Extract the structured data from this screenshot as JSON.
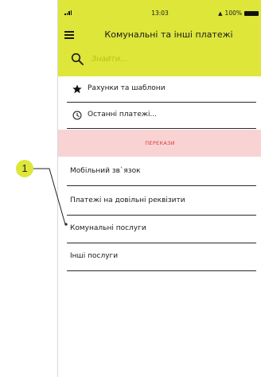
{
  "status_bar": {
    "time": "13:03",
    "battery": "100%"
  },
  "header": {
    "title": "Комунальні та інші платежі"
  },
  "search": {
    "placeholder": "Знайти..."
  },
  "quick_rows": [
    {
      "label": "Рахунки та шаблони",
      "icon": "star-icon"
    },
    {
      "label": "Останні платежі...",
      "icon": "clock-icon"
    }
  ],
  "section": {
    "label": "ПЕРЕКАЗИ"
  },
  "items": [
    {
      "label": "Мобільний зв`язок"
    },
    {
      "label": "Платежі на довільні реквізити"
    },
    {
      "label": "Комунальні послуги"
    },
    {
      "label": "Інші послуги"
    }
  ],
  "callout": {
    "number": "1"
  },
  "colors": {
    "accent": "#dde639",
    "section_bg": "#f9d3d3",
    "section_text": "#d83a3a"
  }
}
